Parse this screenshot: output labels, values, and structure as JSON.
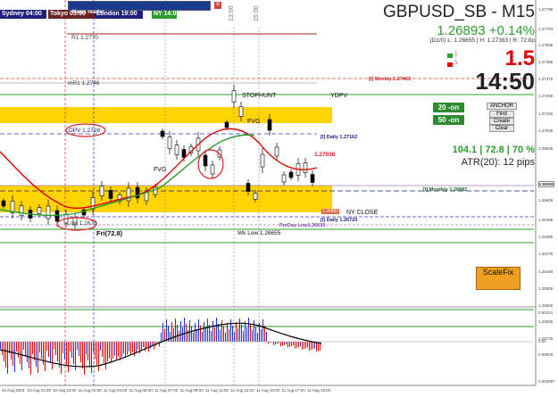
{
  "sessions": [
    {
      "name": "sydney",
      "label": "Sydney 04:00",
      "bg": "#1f1f80"
    },
    {
      "name": "tokyo",
      "label": "Tokyo 03:00",
      "bg": "#6b2222"
    },
    {
      "name": "london",
      "label": "London 19:00",
      "bg": "#1f1f80"
    },
    {
      "name": "ny",
      "label": "NY 14:00",
      "bg": "#2e9e2e"
    }
  ],
  "news_reader": "News reader",
  "symbol_title": "GBPUSD_SB - M15",
  "price_change": "1.26893 +0.14%",
  "ohlc_line": "(D1/0) L: 1.26655 | H: 1.27383 | R: 72.8p",
  "spread": "1.5",
  "clock": "14:50",
  "on_buttons": [
    "20 -on",
    "50 -on"
  ],
  "panel_buttons": [
    "ANCHOR",
    "Find",
    "Create",
    "Clear"
  ],
  "stats_line": "104.1 | 72.8 | 70 %",
  "atr_line": "ATR(20): 12 pips",
  "scalefix_label": "ScaleFix",
  "level_labels": {
    "r1": "R1 1.2770",
    "mr1": "mR1 1.2746",
    "weekly": "[I] Weekly 1.27463",
    "stophunt": "STOPHUNT",
    "ydpv": "YDPV",
    "fvg_top": "FVG",
    "fvg_left": "FVG",
    "dpv": "DPV 1.2728",
    "daily": "[I] Daily 1.27162",
    "price_tag": "1.27036",
    "monthly": "[I] Monthly 1.26882",
    "ny_close": "NY CLOSE",
    "daily2": "[I] Daily 1.26720",
    "prevday_low": "PreDay Low1.26693",
    "wk_low": "Wk Low 1.26655",
    "pivot_low": "Low 1.2670",
    "fri": "Fri(72.8)",
    "chart_price_tags": [
      "1.26893",
      "1.2670"
    ]
  },
  "time_markers": [
    "13:00",
    "15:00"
  ],
  "price_axis": [
    "1.27758",
    "1.27703",
    "1.27595",
    "1.27485",
    "1.27375",
    "1.27265",
    "1.27155",
    "1.27045",
    "1.26935",
    "1.26893",
    "1.26715",
    "1.26605",
    "1.26495",
    "1.26385",
    "1.26275",
    "1.26165",
    "1.26055",
    "1.25945",
    "1.25835",
    "1.25725"
  ],
  "osc_axis": [
    "0.00221",
    "0.00",
    "0.00000",
    "0.003997"
  ],
  "time_axis": [
    "10 Aug 2023",
    "10 Aug 21:00",
    "10 Aug 23:00",
    "11 Aug 01:00",
    "11 Aug 03:00",
    "11 Aug 05:00",
    "11 Aug 07:00",
    "11 Aug 09:00",
    "11 Aug 11:00",
    "11 Aug 13:00",
    "11 Aug 15:00",
    "11 Aug 17:00",
    "11 Aug 19:00"
  ],
  "colors": {
    "up": "#2e9e2e",
    "down": "#e00000",
    "zone": "#ffd400",
    "accent": "#1a1a8c",
    "scalefix": "#f0a020"
  }
}
